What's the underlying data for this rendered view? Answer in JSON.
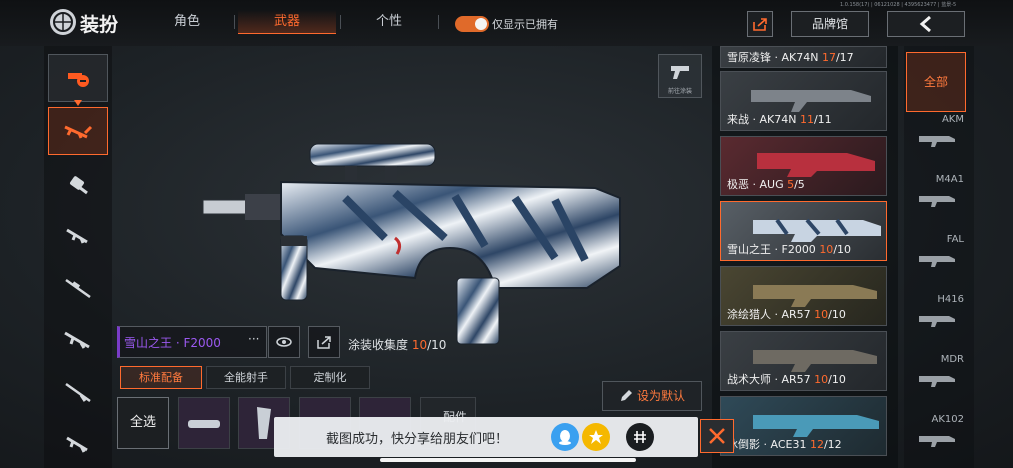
{
  "header": {
    "title": "装扮",
    "tabs": [
      "角色",
      "武器",
      "个性"
    ],
    "active_tab": "武器",
    "toggle_label": "仅显示已拥有",
    "toggle_on": true,
    "brand_button": "品牌馆",
    "version_info": "1.0.158(17) | 06121028 | 4395623477 | 蓝景-5"
  },
  "left_categories": [
    {
      "icon": "explosive-icon"
    },
    {
      "icon": "assault-rifle-icon"
    },
    {
      "icon": "grenade-launcher-icon"
    },
    {
      "icon": "smg-icon"
    },
    {
      "icon": "sniper-rifle-icon"
    },
    {
      "icon": "rifle-icon"
    },
    {
      "icon": "shotgun-icon"
    },
    {
      "icon": "pistol-icon"
    }
  ],
  "weapon": {
    "name": "雪山之王 · F2000",
    "collection_label": "涂装收集度",
    "collection_owned": "10",
    "collection_total": "/10",
    "goto_paint_label": "前往涂装",
    "set_default_label": "设为默认",
    "attachments_label": "配件"
  },
  "subtabs": [
    "标准配备",
    "全能射手",
    "定制化"
  ],
  "active_subtab": "标准配备",
  "select_all_label": "全选",
  "skins": [
    {
      "name": "雪原凌锋 · AK74N",
      "owned": "17",
      "total": "/17"
    },
    {
      "name": "来战 · AK74N",
      "owned": "11",
      "total": "/11"
    },
    {
      "name": "极恶 · AUG",
      "owned": "5",
      "total": "/5"
    },
    {
      "name": "雪山之王 · F2000",
      "owned": "10",
      "total": "/10",
      "active": true
    },
    {
      "name": "涂绘猎人 · AR57",
      "owned": "10",
      "total": "/10"
    },
    {
      "name": "战术大师 · AR57",
      "owned": "10",
      "total": "/10"
    },
    {
      "name": "冰倒影 · ACE31",
      "owned": "12",
      "total": "/12"
    }
  ],
  "right_categories": [
    "全部",
    "AKM",
    "M4A1",
    "FAL",
    "H416",
    "MDR",
    "AK102"
  ],
  "toast": {
    "message": "截图成功，快分享给朋友们吧！"
  },
  "colors": {
    "accent": "#ff6a2e",
    "name_purple": "#9b59f0"
  }
}
